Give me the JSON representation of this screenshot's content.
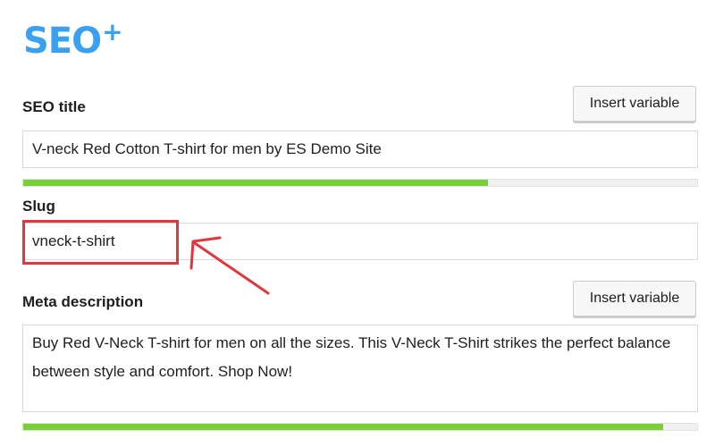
{
  "logo": {
    "text": "SEO",
    "superscript": "+",
    "color": "#3aa0ef"
  },
  "seo_title": {
    "label": "SEO title",
    "insert_variable_label": "Insert variable",
    "value": "V-neck Red Cotton T-shirt for men by ES Demo Site",
    "progress": 0.69,
    "progress_color": "#7ad03a"
  },
  "slug": {
    "label": "Slug",
    "value": "vneck-t-shirt",
    "highlight_color": "#e0373e"
  },
  "meta_description": {
    "label": "Meta description",
    "insert_variable_label": "Insert variable",
    "value": "Buy Red V-Neck T-shirt for men on all the sizes. This V-Neck T-Shirt strikes the perfect balance between style and comfort. Shop Now!",
    "progress": 0.95,
    "progress_color": "#7ad03a"
  }
}
